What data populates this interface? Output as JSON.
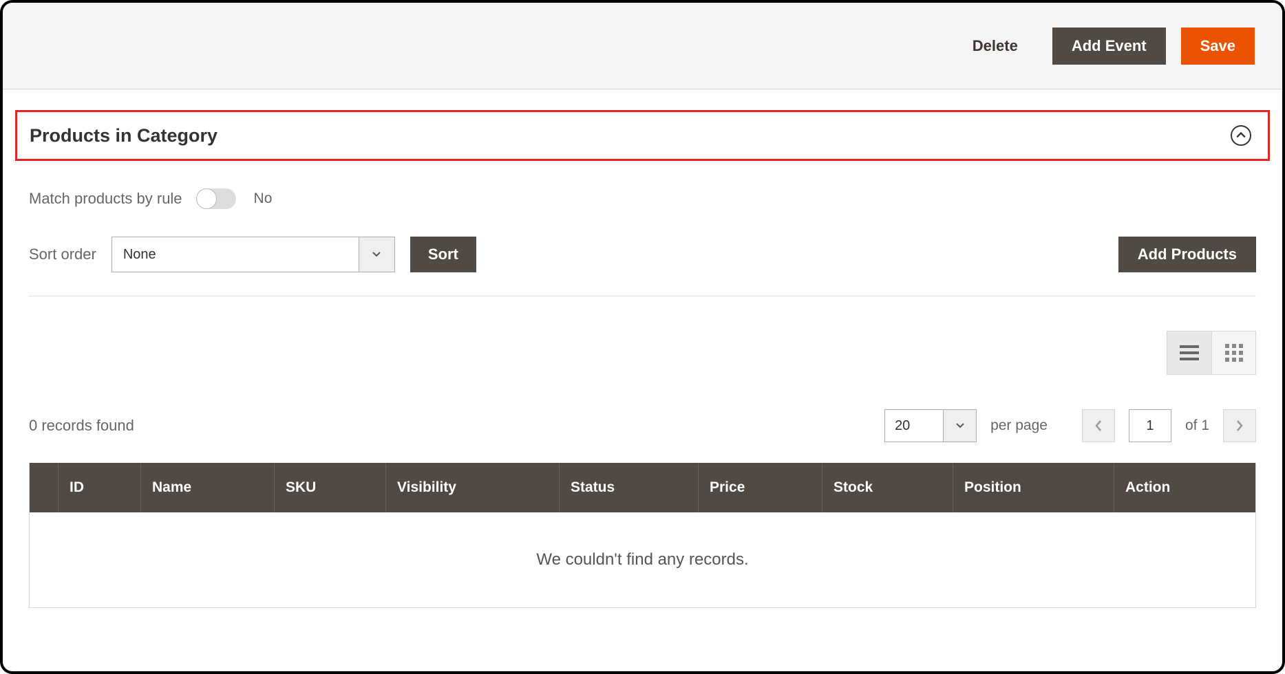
{
  "top": {
    "delete": "Delete",
    "add_event": "Add Event",
    "save": "Save"
  },
  "section": {
    "title": "Products in Category"
  },
  "match": {
    "label": "Match products by rule",
    "state": "No"
  },
  "sort": {
    "label": "Sort order",
    "value": "None",
    "button": "Sort"
  },
  "add_products": "Add Products",
  "grid": {
    "records_found": "0 records found",
    "page_size": "20",
    "per_page": "per page",
    "current_page": "1",
    "of": "of 1",
    "empty": "We couldn't find any records.",
    "columns": {
      "id": "ID",
      "name": "Name",
      "sku": "SKU",
      "visibility": "Visibility",
      "status": "Status",
      "price": "Price",
      "stock": "Stock",
      "position": "Position",
      "action": "Action"
    }
  }
}
